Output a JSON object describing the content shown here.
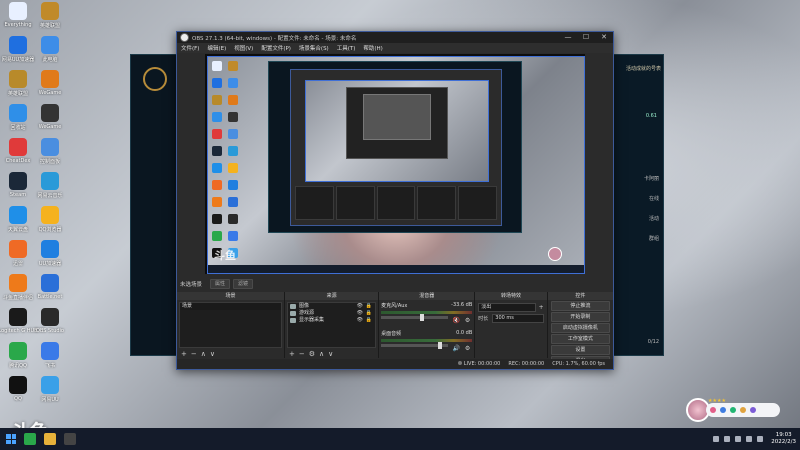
{
  "desktop": {
    "icons": [
      {
        "label": "Everything",
        "color": "#e8f0ff"
      },
      {
        "label": "英雄联盟",
        "color": "#c08a2a"
      },
      {
        "label": "网易UU加速器",
        "color": "#1f6fe0"
      },
      {
        "label": "此电脑",
        "color": "#3d8de8"
      },
      {
        "label": "英雄联盟",
        "color": "#b88a2a"
      },
      {
        "label": "WeGame",
        "color": "#e07a1a"
      },
      {
        "label": "回收站",
        "color": "#2f8fe8"
      },
      {
        "label": "WeGame",
        "color": "#333333"
      },
      {
        "label": "CheatDex",
        "color": "#e03a3a"
      },
      {
        "label": "控制面板",
        "color": "#4a8ee0"
      },
      {
        "label": "Steam",
        "color": "#1b2838"
      },
      {
        "label": "网易云音乐",
        "color": "#2a9ad8"
      },
      {
        "label": "天翼云盘",
        "color": "#1f8fe8"
      },
      {
        "label": "QQ浏览器",
        "color": "#f5b21e"
      },
      {
        "label": "迅雷",
        "color": "#ef6a25"
      },
      {
        "label": "UU加速器",
        "color": "#1f7fe0"
      },
      {
        "label": "斗鱼直播伴侣",
        "color": "#ee7a1a"
      },
      {
        "label": "Battle.net",
        "color": "#2a6fd8"
      },
      {
        "label": "Logitech G HUB",
        "color": "#1a1a1a"
      },
      {
        "label": "OBS Studio",
        "color": "#2a2a2a"
      },
      {
        "label": "腾讯QQ",
        "color": "#2aa84a"
      },
      {
        "label": "飞书",
        "color": "#3a7ae8"
      },
      {
        "label": "QQ",
        "color": "#111111"
      },
      {
        "label": "网易UU",
        "color": "#3aa0e8"
      }
    ]
  },
  "lol_client": {
    "right_title": "活动成就的号表",
    "right_number": "0.61",
    "rows": [
      "卡阿丽",
      "在线",
      "活动",
      "群组",
      "0/12"
    ]
  },
  "obs": {
    "title": "OBS 27.1.3 (64-bit, windows) - 配置文件: 未命名 - 场景: 未命名",
    "window_controls": {
      "minimize": "—",
      "maximize": "☐",
      "close": "✕"
    },
    "menu": [
      "文件(F)",
      "编辑(E)",
      "视图(V)",
      "配置文件(P)",
      "场景集合(S)",
      "工具(T)",
      "帮助(H)"
    ],
    "scene_bar": {
      "current": "未选场景",
      "btn1": "属性",
      "btn2": "滤镜"
    },
    "docks": {
      "scenes": {
        "title": "场景",
        "items": [
          "场景"
        ],
        "footer": [
          "+",
          "−",
          "∧",
          "∨"
        ]
      },
      "sources": {
        "title": "来源",
        "items": [
          {
            "name": "图像",
            "eye": "👁",
            "lock": "🔒"
          },
          {
            "name": "游戏源",
            "eye": "👁",
            "lock": "🔒"
          },
          {
            "name": "显示器采集",
            "eye": "👁",
            "lock": "🔒"
          }
        ],
        "footer": [
          "+",
          "−",
          "⚙",
          "∧",
          "∨"
        ]
      },
      "mixer": {
        "title": "混音器",
        "channels": [
          {
            "name": "麦克风/Aux",
            "db": "-33.6 dB",
            "level": 0.58,
            "gear": "⚙",
            "mute": "🔇"
          },
          {
            "name": "桌面音频",
            "db": "0.0 dB",
            "level": 0.85,
            "gear": "⚙",
            "mute": "🔊"
          }
        ]
      },
      "transitions": {
        "title": "转场特效",
        "type": "淡出",
        "duration_label": "时长",
        "duration": "300 ms",
        "plus": "+"
      },
      "controls": {
        "title": "控件",
        "buttons": [
          "停止推流",
          "开始录制",
          "启动虚拟摄像机",
          "工作室模式",
          "设置",
          "退出"
        ]
      }
    },
    "status": {
      "live": "LIVE: 00:00:00",
      "rec": "REC: 00:00:00",
      "cpu": "CPU: 1.7%, 60.00 fps"
    },
    "preview_watermark": "斗鱼"
  },
  "overlay": {
    "watermark": "斗鱼",
    "stars": "★★★★"
  },
  "taskbar": {
    "apps": [
      {
        "name": "wechat",
        "color": "#2aa84a"
      },
      {
        "name": "explorer",
        "color": "#e8b23a"
      },
      {
        "name": "obs",
        "color": "#444444"
      }
    ],
    "time": "19:03",
    "date": "2022/2/3"
  }
}
